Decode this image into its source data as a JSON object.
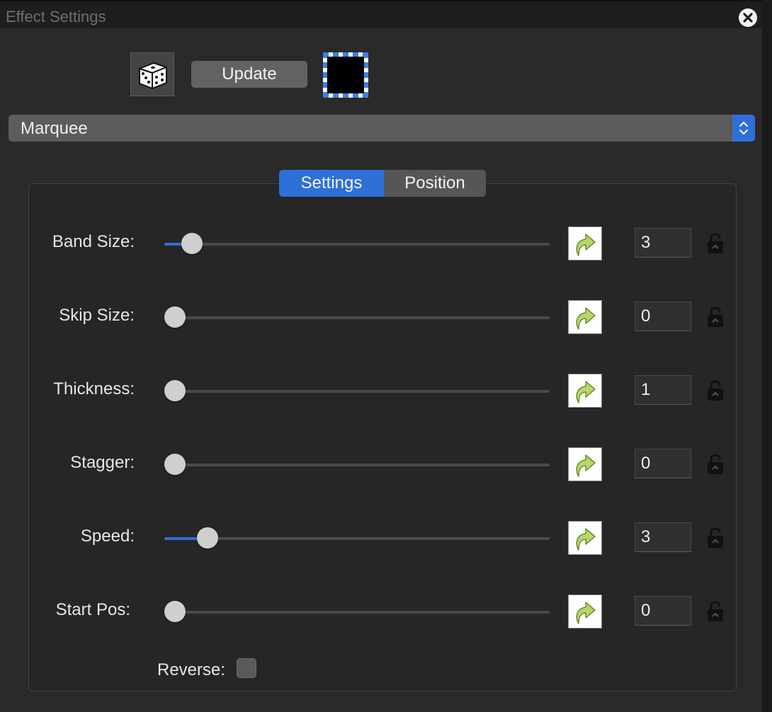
{
  "window": {
    "title": "Effect Settings"
  },
  "toolbar": {
    "update_label": "Update",
    "swatch_color": "#000000"
  },
  "effect_select": {
    "value": "Marquee"
  },
  "tabs": [
    {
      "label": "Settings",
      "active": true
    },
    {
      "label": "Position",
      "active": false
    }
  ],
  "rows": [
    {
      "label": "Band Size:",
      "value": "3",
      "slider_fraction": 0.045
    },
    {
      "label": "Skip Size:",
      "value": "0",
      "slider_fraction": 0.0
    },
    {
      "label": "Thickness:",
      "value": "1",
      "slider_fraction": 0.0
    },
    {
      "label": "Stagger:",
      "value": "0",
      "slider_fraction": 0.0
    },
    {
      "label": "Speed:",
      "value": "3",
      "slider_fraction": 0.085
    },
    {
      "label": "Start Pos:",
      "value": "0",
      "slider_fraction": 0.0
    }
  ],
  "reverse": {
    "label": "Reverse:",
    "checked": false
  },
  "colors": {
    "accent": "#2f6fd8",
    "background": "#2a2a2a"
  }
}
